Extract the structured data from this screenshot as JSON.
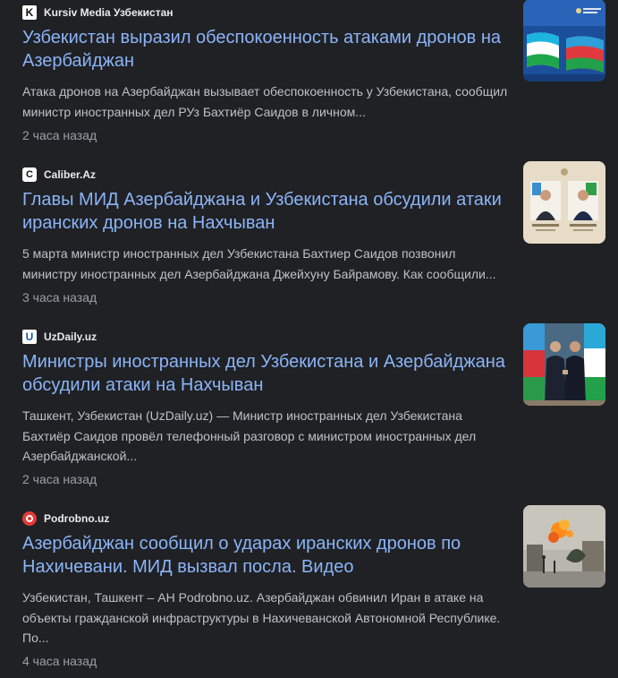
{
  "articles": [
    {
      "source": "Kursiv Media Узбекистан",
      "favicon_icon": "kursiv-logo-icon",
      "favicon_letter": "K",
      "headline": "Узбекистан выразил обеспокоенность атаками дронов на Азербайджан",
      "snippet": "Атака дронов на Азербайджан вызывает обеспокоенность у Узбекистана, сообщил министр иностранных дел РУз Бахтиёр Саидов в личном...",
      "time": "2 часа назад",
      "thumbnail": "flags-uzbekistan-azerbaijan"
    },
    {
      "source": "Caliber.Az",
      "favicon_icon": "caliber-logo-icon",
      "favicon_letter": "C",
      "headline": "Главы МИД Азербайджана и Узбекистана обсудили атаки иранских дронов на Нахчыван",
      "snippet": "5 марта министр иностранных дел Узбекистана Бахтиер Саидов позвонил министру иностранных дел Азербайджана Джейхуну Байрамову. Как сообщили...",
      "time": "3 часа назад",
      "thumbnail": "foreign-ministers-portraits"
    },
    {
      "source": "UzDaily.uz",
      "favicon_icon": "uzdaily-logo-icon",
      "favicon_letter": "U",
      "headline": "Министры иностранных дел Узбекистана и Азербайджана обсудили атаки на Нахчыван",
      "snippet": "Ташкент, Узбекистан (UzDaily.uz) — Министр иностранных дел Узбекистана Бахтиёр Саидов провёл телефонный разговор с министром иностранных дел Азербайджанской...",
      "time": "2 часа назад",
      "thumbnail": "ministers-handshake"
    },
    {
      "source": "Podrobno.uz",
      "favicon_icon": "podrobno-logo-icon",
      "favicon_letter": "",
      "headline": "Азербайджан сообщил о ударах иранских дронов по Нахичевани. МИД вызвал посла. Видео",
      "snippet": "Узбекистан, Ташкент – АН Podrobno.uz. Азербайджан обвинил Иран в атаке на объекты гражданской инфраструктуры в Нахичеванской Автономной Республике. По...",
      "time": "4 часа назад",
      "thumbnail": "explosion-scene"
    }
  ],
  "colors": {
    "background": "#202124",
    "headline": "#8ab4f8",
    "snippet": "#bdc1c6",
    "source": "#e8eaed",
    "time": "#9aa0a6"
  }
}
